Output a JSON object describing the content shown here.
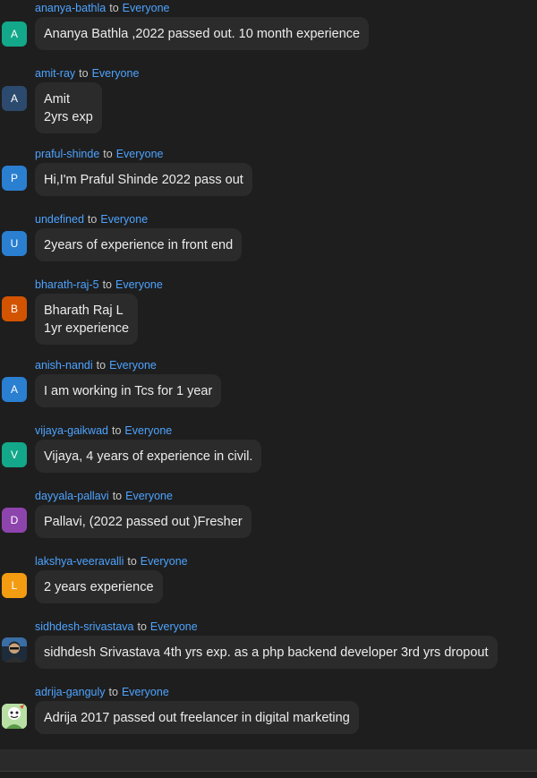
{
  "to_word": "to",
  "messages": [
    {
      "sender": "ananya-bathla",
      "target": "Everyone",
      "avatar_letter": "A",
      "avatar_color": "#13a88a",
      "lines": [
        "Ananya Bathla ,2022 passed out. 10 month experience"
      ]
    },
    {
      "sender": "amit-ray",
      "target": "Everyone",
      "avatar_letter": "A",
      "avatar_color": "#2c4a6e",
      "lines": [
        "Amit",
        "2yrs exp"
      ]
    },
    {
      "sender": "praful-shinde",
      "target": "Everyone",
      "avatar_letter": "P",
      "avatar_color": "#2a7fd1",
      "lines": [
        "Hi,I'm Praful Shinde 2022 pass out"
      ]
    },
    {
      "sender": "undefined",
      "target": "Everyone",
      "avatar_letter": "U",
      "avatar_color": "#2a7fd1",
      "lines": [
        "2years of experience in front end"
      ]
    },
    {
      "sender": "bharath-raj-5",
      "target": "Everyone",
      "avatar_letter": "B",
      "avatar_color": "#d35400",
      "lines": [
        "Bharath Raj L",
        "1yr experience"
      ]
    },
    {
      "sender": "anish-nandi",
      "target": "Everyone",
      "avatar_letter": "A",
      "avatar_color": "#2a7fd1",
      "lines": [
        "I am working in Tcs for 1 year"
      ]
    },
    {
      "sender": "vijaya-gaikwad",
      "target": "Everyone",
      "avatar_letter": "V",
      "avatar_color": "#13a88a",
      "lines": [
        "Vijaya, 4 years of experience in civil."
      ]
    },
    {
      "sender": "dayyala-pallavi",
      "target": "Everyone",
      "avatar_letter": "D",
      "avatar_color": "#8e44ad",
      "lines": [
        "Pallavi, (2022 passed out )Fresher"
      ]
    },
    {
      "sender": "lakshya-veeravalli",
      "target": "Everyone",
      "avatar_letter": "L",
      "avatar_color": "#f39c12",
      "lines": [
        "2 years experience"
      ]
    },
    {
      "sender": "sidhdesh-srivastava",
      "target": "Everyone",
      "avatar_letter": "",
      "avatar_color": "#1d2b3a",
      "avatar_image": "photo-avatar",
      "lines": [
        "sidhdesh Srivastava 4th yrs exp. as a php backend developer 3rd yrs dropout"
      ]
    },
    {
      "sender": "adrija-ganguly",
      "target": "Everyone",
      "avatar_letter": "",
      "avatar_color": "#9fd08a",
      "avatar_image": "cartoon-avatar",
      "lines": [
        "Adrija 2017 passed out freelancer in digital marketing"
      ]
    }
  ]
}
